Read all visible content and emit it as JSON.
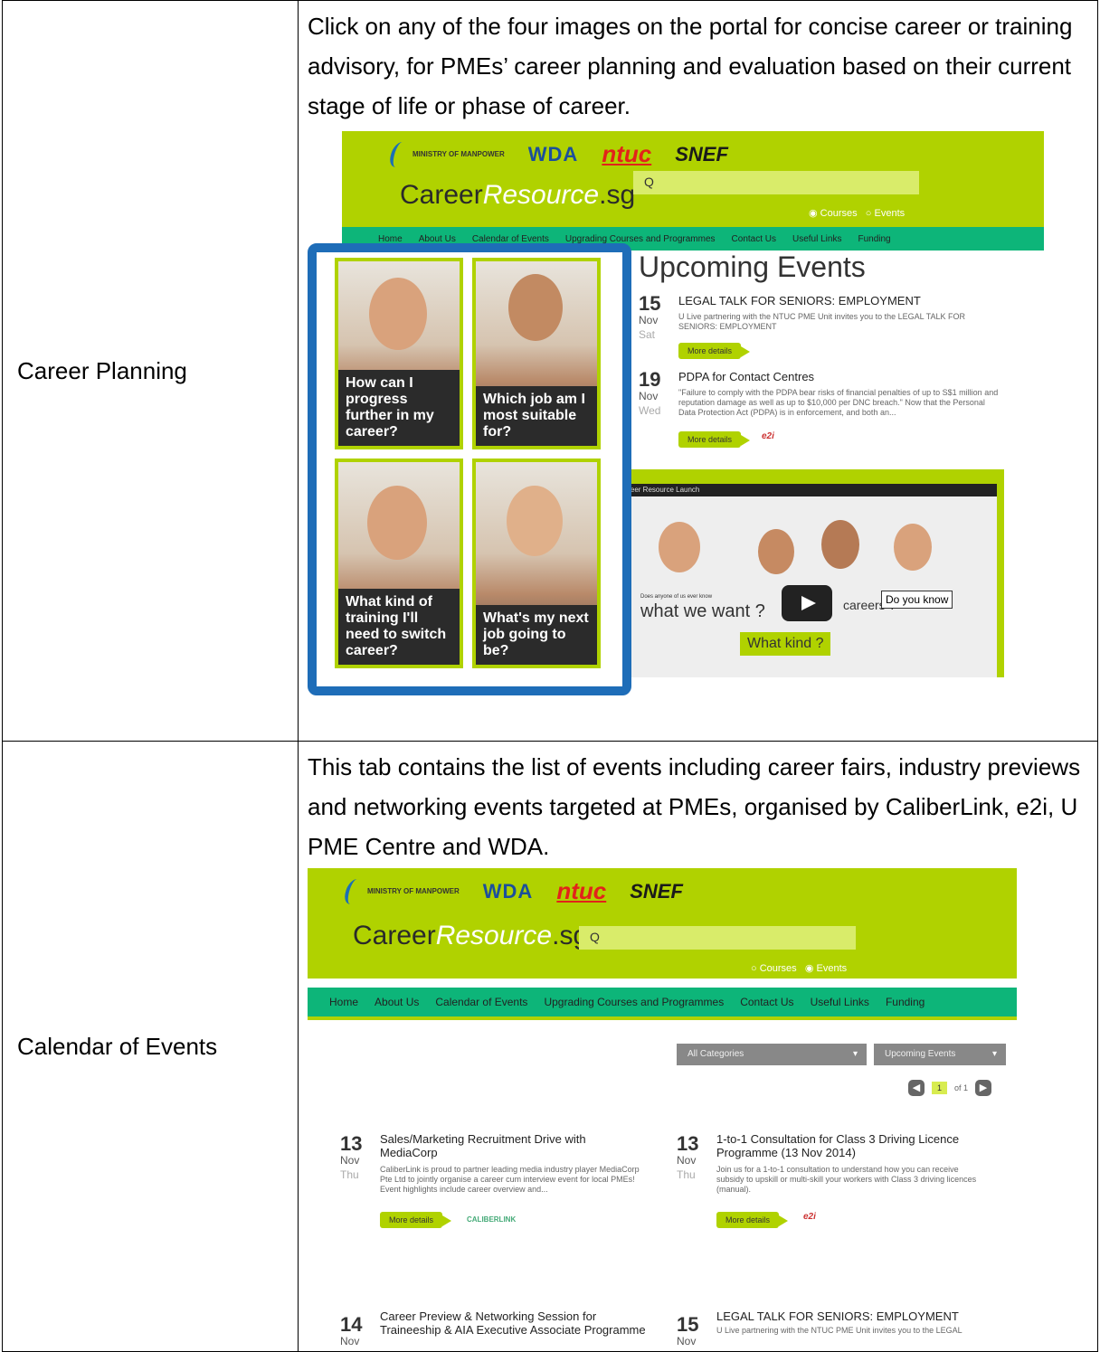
{
  "rows": [
    {
      "label": "Career Planning",
      "description": "Click on any of the four images on the portal for concise career or training advisory, for PMEs’ career planning and evaluation based on their current stage of life or phase of career."
    },
    {
      "label": "Calendar of Events",
      "description": "This tab contains the list of events including career fairs, industry previews and networking events targeted at PMEs, organised by CaliberLink, e2i, U PME Centre and WDA."
    }
  ],
  "site": {
    "logos": {
      "mom": "MINISTRY OF MANPOWER",
      "wda": "WDA",
      "ntuc": "ntuc",
      "snef": "SNEF"
    },
    "brand_a": "Career",
    "brand_b": "Resource",
    "brand_c": ".sg",
    "search_icon": "Q",
    "nav": [
      "Home",
      "About Us",
      "Calendar of Events",
      "Upgrading Courses and Programmes",
      "Contact Us",
      "Useful Links",
      "Funding"
    ],
    "radio_courses": "Courses",
    "radio_events": "Events",
    "colors": {
      "header": "#b0d200",
      "nav": "#0db579",
      "frame": "#1e6db8"
    }
  },
  "shot1": {
    "heading": "Upcoming Events",
    "tiles": [
      "How can I progress further in my career?",
      "Which job am I most suitable for?",
      "What kind of training I'll need to switch career?",
      "What's my next job going to be?"
    ],
    "events": [
      {
        "day": "15",
        "mon": "Nov",
        "dow": "Sat",
        "title": "LEGAL TALK FOR SENIORS: EMPLOYMENT",
        "text": "U Live partnering with the NTUC PME Unit invites you to the LEGAL TALK FOR SENIORS: EMPLOYMENT",
        "more": "More details"
      },
      {
        "day": "19",
        "mon": "Nov",
        "dow": "Wed",
        "title": "PDPA for Contact Centres",
        "text": "\"Failure to comply with the PDPA bear risks of financial penalties of up to S$1 million and reputation damage as well as up to $10,000 per DNC breach.\" Now that the Personal Data Protection Act (PDPA) is in enforcement, and both an...",
        "more": "More details",
        "partner": "e2i"
      }
    ],
    "video_title": "Career Resource Launch",
    "video_caption_small": "Does anyone of us ever know",
    "video_caption_big": "what we want",
    "video_careers": "careers",
    "video_doyouknow": "Do you know",
    "video_whatkind": "What kind"
  },
  "shot2": {
    "dd_categories": "All Categories",
    "dd_events": "Upcoming Events",
    "page_current": "1",
    "page_of": "of 1",
    "events": [
      {
        "day": "13",
        "mon": "Nov",
        "dow": "Thu",
        "title": "Sales/Marketing Recruitment Drive with MediaCorp",
        "text": "CaliberLink is proud to partner leading media industry player MediaCorp Pte Ltd to jointly organise a career cum interview event for local PMEs! Event highlights include career overview and...",
        "more": "More details",
        "partner": "CALIBERLINK"
      },
      {
        "day": "13",
        "mon": "Nov",
        "dow": "Thu",
        "title": "1-to-1 Consultation for Class 3 Driving Licence Programme (13 Nov 2014)",
        "text": "Join us for a 1-to-1 consultation to understand how you can receive subsidy to upskill or multi-skill your workers with Class 3 driving licences (manual).",
        "more": "More details",
        "partner": "e2i"
      },
      {
        "day": "14",
        "mon": "Nov",
        "title": "Career Preview & Networking Session for Traineeship & AIA Executive Associate Programme"
      },
      {
        "day": "15",
        "mon": "Nov",
        "title": "LEGAL TALK FOR SENIORS: EMPLOYMENT",
        "text": "U Live partnering with the NTUC PME Unit invites you to the LEGAL"
      }
    ]
  }
}
